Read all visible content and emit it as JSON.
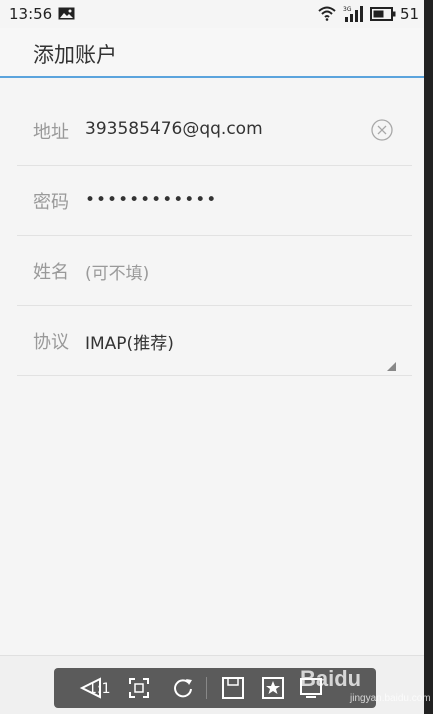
{
  "status_bar": {
    "time": "13:56",
    "battery_level": "51",
    "icons": [
      "gallery-icon",
      "wifi-icon",
      "signal-3g-icon",
      "battery-icon"
    ]
  },
  "app_bar": {
    "title": "添加账户",
    "accent_color": "#5ba4dd"
  },
  "form": {
    "address": {
      "label": "地址",
      "value": "393585476@qq.com",
      "clear_icon": "clear-circle-icon"
    },
    "password": {
      "label": "密码",
      "value": "••••••••••••"
    },
    "name": {
      "label": "姓名",
      "placeholder": "(可不填)"
    },
    "protocol": {
      "label": "协议",
      "value": "IMAP(推荐)",
      "dropdown_icon": "dropdown-corner-icon"
    }
  },
  "viewer_toolbar": {
    "actual_size_label": "1:1",
    "icons": [
      "back-triangle-icon",
      "fit-screen-icon",
      "rotate-icon",
      "save-icon",
      "favorite-icon",
      "fullscreen-icon"
    ]
  },
  "watermark": {
    "text": "Baidu",
    "sub": "jingyan.baidu.com"
  }
}
